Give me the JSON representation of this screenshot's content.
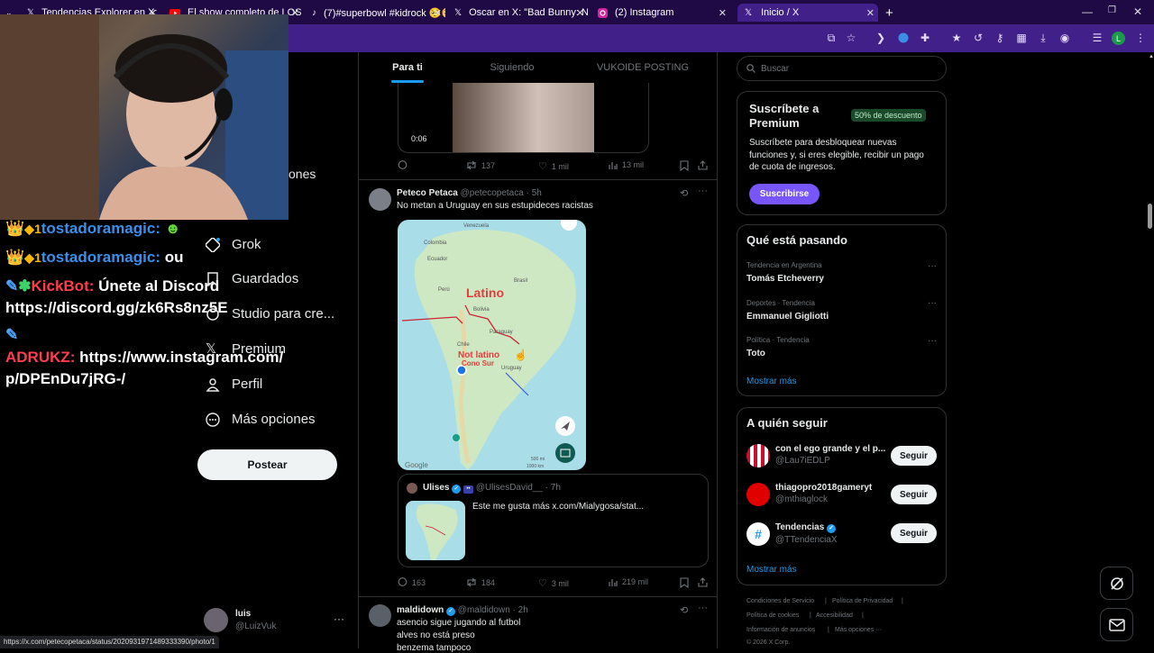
{
  "browser": {
    "tabs": [
      {
        "title": "Tendencias Explorer en X: \"\"Lat",
        "icon": "x"
      },
      {
        "title": "El show completo de LOS PAL",
        "icon": "youtube"
      },
      {
        "title": "(7)#superbowl #kidrock 🥺🥺",
        "icon": "tiktok"
      },
      {
        "title": "Oscar en X: \"Bad Bunny: No m",
        "icon": "x"
      },
      {
        "title": "(2) Instagram",
        "icon": "instagram"
      },
      {
        "title": "Inicio / X",
        "icon": "x"
      }
    ],
    "status_url": "https://x.com/petecopetaca/status/2020931971489333390/photo/1",
    "profile_initial": "L"
  },
  "stream_chat": {
    "line1_user": "tostadoramagic:",
    "line2_user": "tostadoramagic:",
    "line2_msg": "ou",
    "kickbot_user": "KickBot:",
    "kickbot_msg": "Únete al Discord",
    "kickbot_link": "https://discord.gg/zk6Rs8nz5E",
    "adrukz_user": "ADRUKZ:",
    "adrukz_link1": "https://www.instagram.com/",
    "adrukz_link2": "p/DPEnDu7jRG-/"
  },
  "sidebar": {
    "partial_item": "ones",
    "items": [
      {
        "label": "Grok",
        "icon": "grok-icon"
      },
      {
        "label": "Guardados",
        "icon": "bookmark-icon"
      },
      {
        "label": "Studio para cre...",
        "icon": "studio-icon"
      },
      {
        "label": "Premium",
        "icon": "x-logo-icon"
      },
      {
        "label": "Perfil",
        "icon": "person-icon"
      },
      {
        "label": "Más opciones",
        "icon": "more-circle-icon"
      }
    ],
    "post_button": "Postear",
    "account_name": "luis",
    "account_handle": "@LuizVuk"
  },
  "timeline": {
    "tabs": [
      "Para ti",
      "Siguiendo",
      "VUKOIDE POSTING"
    ],
    "video_time": "0:06",
    "top_stats": {
      "retweets": "137",
      "likes": "1 mil",
      "views": "13 mil"
    },
    "post1": {
      "name": "Peteco Petaca",
      "handle": "@petecopetaca · 5h",
      "text": "No metan a Uruguay en sus estupideces racistas",
      "map_labels": {
        "venezuela": "Venezuela",
        "colombia": "Colombia",
        "ecuador": "Ecuador",
        "peru": "Perú",
        "brasil": "Brasil",
        "bolivia": "Bolivia",
        "paraguay": "Paraguay",
        "chile": "Chile",
        "uruguay": "Uruguay",
        "latino": "Latino",
        "not_latino": "Not latino",
        "cono_sur": "Cono Sur",
        "google": "Google",
        "scale1": "500 mi",
        "scale2": "1000 km"
      },
      "quote": {
        "name": "Ulises",
        "handle": "@UlisesDavid__ · 7h",
        "text": "Este me gusta más  x.com/Mialygosa/stat..."
      },
      "stats": {
        "replies": "163",
        "retweets": "184",
        "likes": "3 mil",
        "views": "219 mil"
      }
    },
    "post2": {
      "name": "maldidown",
      "handle": "@maldidown · 2h",
      "lines": [
        "asencio sigue jugando al futbol",
        "alves no está preso",
        "benzema tampoco"
      ]
    }
  },
  "right": {
    "search_placeholder": "Buscar",
    "premium": {
      "title_line1": "Suscríbete a",
      "title_line2": "Premium",
      "badge": "50% de descuento",
      "desc_line1": "Suscríbete para desbloquear nuevas",
      "desc_line2": "funciones y, si eres elegible, recibir un pago",
      "desc_line3": "de cuota de ingresos.",
      "button": "Suscribirse"
    },
    "trends": {
      "title": "Qué está pasando",
      "items": [
        {
          "meta": "Tendencia en Argentina",
          "name": "Tomás Etcheverry"
        },
        {
          "meta": "Deportes · Tendencia",
          "name": "Emmanuel Gigliotti"
        },
        {
          "meta": "Política · Tendencia",
          "name": "Toto"
        }
      ],
      "more": "Mostrar más"
    },
    "follow": {
      "title": "A quién seguir",
      "items": [
        {
          "name": "con el ego grande y el p...",
          "handle": "@Lau7iEDLP",
          "avatar_color": "#c8102e"
        },
        {
          "name": "thiagopro2018gameryt",
          "handle": "@mthiaglock",
          "avatar_color": "#e00000"
        },
        {
          "name": "Tendencias",
          "handle": "@TTendenciaX",
          "avatar_color": "#ffffff"
        }
      ],
      "button": "Seguir",
      "more": "Mostrar más"
    },
    "footer": {
      "l1a": "Condiciones de Servicio",
      "l1b": "Política de Privacidad",
      "l2a": "Política de cookies",
      "l2b": "Accesibilidad",
      "l3a": "Información de anuncios",
      "l3b": "Más opciones ···",
      "copy": "© 2026 X Corp."
    }
  },
  "colors": {
    "accent": "#1d9bf0",
    "premium_btn": "#7856ff",
    "browser_bg": "#42208a"
  }
}
